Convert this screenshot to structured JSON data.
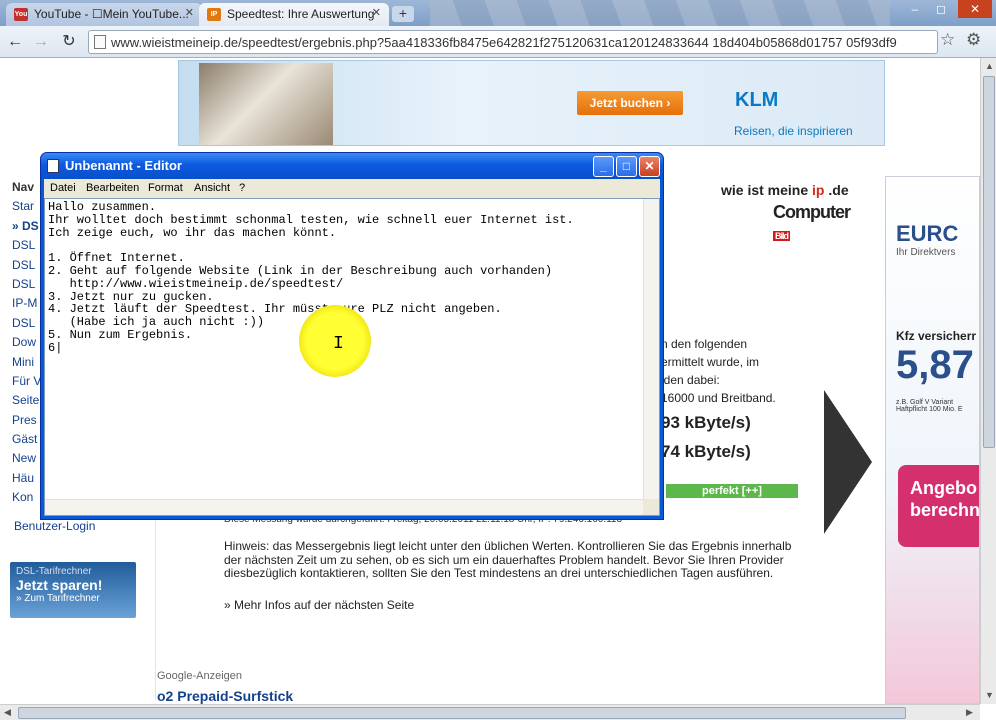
{
  "tabs": [
    {
      "label": "YouTube - ☐Mein YouTube...",
      "favicon": "You"
    },
    {
      "label": "Speedtest: Ihre Auswertung",
      "favicon": "IP"
    }
  ],
  "window_controls": [
    "–",
    "◻",
    "✕"
  ],
  "address": "www.wieistmeineip.de/speedtest/ergebnis.php?5aa418336fb8475e642821f275120631ca120124833644 18d404b05868d01757 05f93df9",
  "icons": {
    "back": "back-arrow-icon",
    "forward": "forward-arrow-icon",
    "reload": "reload-icon",
    "bookmark": "star-icon",
    "menu": "wrench-icon"
  },
  "banner": {
    "button": "Jetzt buchen ›",
    "brand": "KLM",
    "slogan": "Reisen, die inspirieren"
  },
  "sidebar": {
    "heading": "Nav",
    "items": [
      "Star",
      "» DS",
      "DSL",
      "DSL",
      "DSL",
      "IP-M",
      "DSL",
      "Dow",
      "Mini",
      "Für V",
      "Seite",
      "Pres",
      "Gäst",
      "New",
      "Häu",
      "Kon"
    ],
    "login": "Benutzer-Login"
  },
  "tarif": {
    "title": "DSL-Tarifrechner",
    "cta": "Jetzt sparen!",
    "link": "» Zum Tarifrechner"
  },
  "site_logo": {
    "a": "wie ist meine ",
    "b": "ip",
    "c": " .de",
    "sub": "Computer",
    "bild": "Bild"
  },
  "result_text": [
    "n den folgenden",
    "ermittelt wurde, im",
    "iden dabei:",
    "16000 und Breitband."
  ],
  "speed_down": "93 kByte/s)",
  "speed_up": "74 kByte/s)",
  "rating": "perfekt [++]",
  "measure": "Diese Messung wurde durchgeführt: Freitag, 20.05.2011 22:11:18 Uhr, IP: 79.246.160.113",
  "hinweis": "Hinweis: das Messergebnis liegt leicht unter den üblichen Werten. Kontrollieren Sie das Ergebnis innerhalb der nächsten Zeit um zu sehen, ob es sich um ein dauerhaftes Problem handelt. Bevor Sie Ihren Provider diesbezüglich kontaktieren, sollten Sie den Test mindestens an drei unterschiedlichen Tagen ausführen.",
  "mehr": "» Mehr Infos auf der nächsten Seite",
  "google": "Google-Anzeigen",
  "o2": "o2 Prepaid-Surfstick",
  "right_ad": {
    "brand": "EURC",
    "sub": "Ihr Direktvers",
    "kfz": "Kfz versicherr",
    "price": "5,87",
    "small": "z.B. Golf V Variant Haftpflicht 100 Mio. E",
    "angebot": "Angebo berechn"
  },
  "notepad": {
    "title": "Unbenannt - Editor",
    "menu": [
      "Datei",
      "Bearbeiten",
      "Format",
      "Ansicht",
      "?"
    ],
    "buttons": [
      "_",
      "□",
      "✕"
    ],
    "text": "Hallo zusammen.\nIhr wolltet doch bestimmt schonmal testen, wie schnell euer Internet ist.\nIch zeige euch, wo ihr das machen könnt.\n\n1. Öffnet Internet.\n2. Geht auf folgende Website (Link in der Beschreibung auch vorhanden)\n   http://www.wieistmeineip.de/speedtest/\n3. Jetzt nur zu gucken.\n4. Jetzt läuft der Speedtest. Ihr müsst eure PLZ nicht angeben.\n   (Habe ich ja auch nicht :))\n5. Nun zum Ergebnis.\n6|"
  }
}
